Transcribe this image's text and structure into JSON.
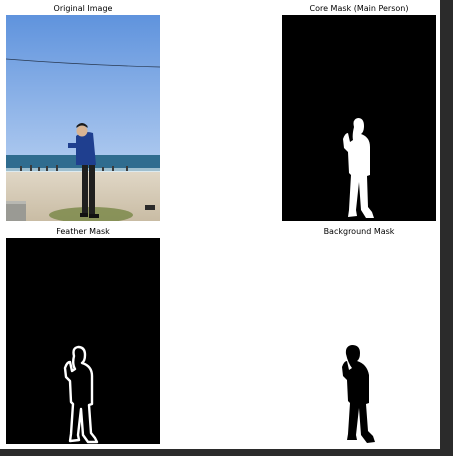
{
  "figure": {
    "panels": [
      {
        "title": "Original Image"
      },
      {
        "title": "Core Mask (Main Person)"
      },
      {
        "title": "Feather Mask"
      },
      {
        "title": "Background Mask"
      }
    ]
  },
  "colors": {
    "background": "#ffffff",
    "frame": "#2b2b2b",
    "mask_fg": "#ffffff",
    "mask_bg": "#000000",
    "sky": "#6e9ee0",
    "sea": "#2f6c8f",
    "sand": "#d9cfbd"
  }
}
